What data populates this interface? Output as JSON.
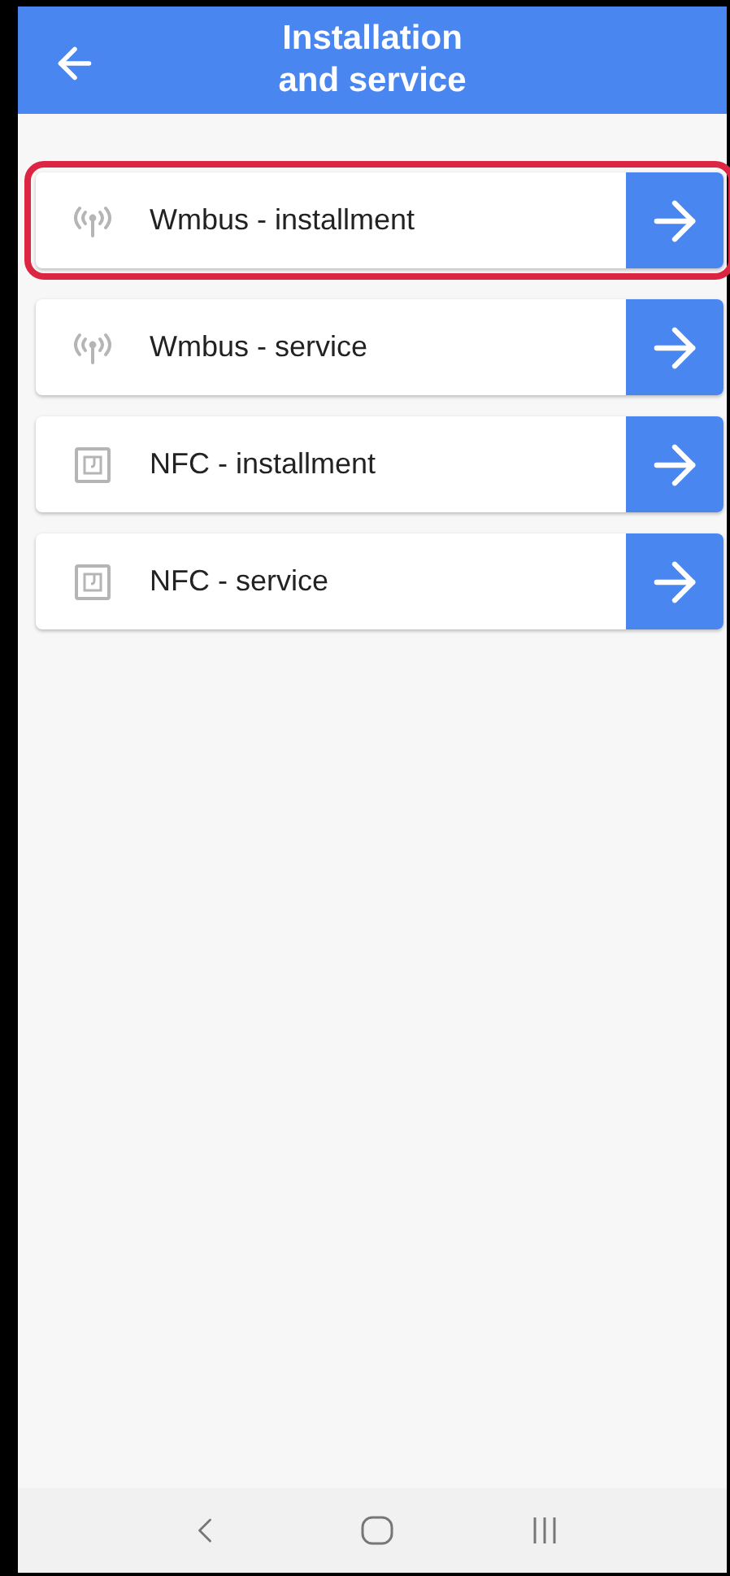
{
  "header": {
    "title": "Installation\nand service"
  },
  "items": [
    {
      "kind": "radio",
      "label": "Wmbus - installment",
      "highlighted": true
    },
    {
      "kind": "radio",
      "label": "Wmbus - service",
      "highlighted": false
    },
    {
      "kind": "nfc",
      "label": "NFC - installment",
      "highlighted": false
    },
    {
      "kind": "nfc",
      "label": "NFC - service",
      "highlighted": false
    }
  ]
}
